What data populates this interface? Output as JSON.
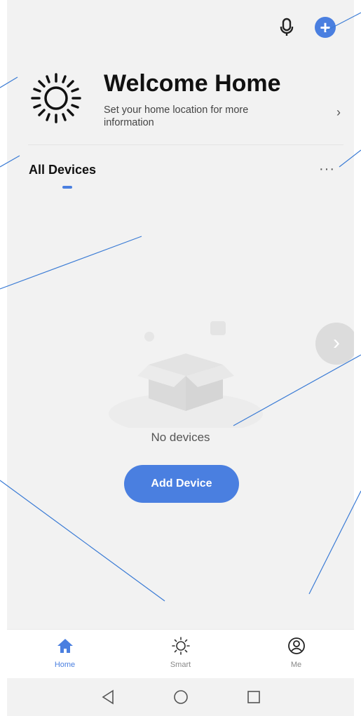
{
  "theme": {
    "accent": "#4a7fe0",
    "background": "#f2f2f2",
    "line": "#3a7bd5"
  },
  "header": {
    "mic_icon": "microphone-icon",
    "add_icon": "plus-circle-icon"
  },
  "welcome": {
    "icon": "sun-icon",
    "title": "Welcome Home",
    "subtitle": "Set your home location for more information",
    "chevron": "›"
  },
  "devices": {
    "section_label": "All Devices",
    "more_label": "···",
    "empty_text": "No devices",
    "add_button": "Add Device",
    "float_arrow": "›"
  },
  "bottom_nav": {
    "items": [
      {
        "label": "Home",
        "icon": "home-icon",
        "active": true
      },
      {
        "label": "Smart",
        "icon": "sun-icon",
        "active": false
      },
      {
        "label": "Me",
        "icon": "user-circle-icon",
        "active": false
      }
    ]
  },
  "system_nav": {
    "back": "back-triangle-icon",
    "home": "home-circle-icon",
    "recents": "recents-square-icon"
  }
}
